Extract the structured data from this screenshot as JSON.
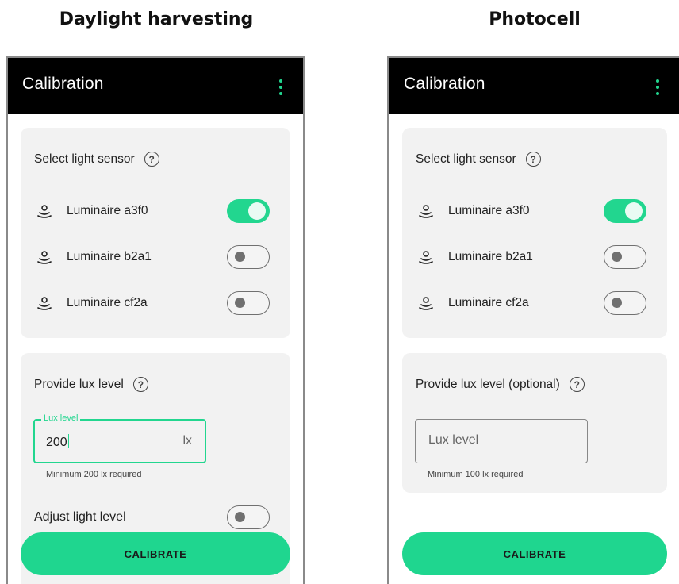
{
  "columns": {
    "left_title": "Daylight harvesting",
    "right_title": "Photocell"
  },
  "left": {
    "appbar": {
      "title": "Calibration",
      "menu_icon": "more-vert-icon"
    },
    "sensor_section": {
      "title": "Select light sensor",
      "help": "?",
      "sensors": [
        {
          "label": "Luminaire a3f0",
          "on": true
        },
        {
          "label": "Luminaire b2a1",
          "on": false
        },
        {
          "label": "Luminaire cf2a",
          "on": false
        }
      ]
    },
    "lux_section": {
      "title": "Provide lux level",
      "help": "?",
      "field_label": "Lux level",
      "field_value": "200",
      "unit": "lx",
      "helper": "Minimum 200 lx required"
    },
    "adjust": {
      "label": "Adjust light level",
      "on": false
    },
    "button": "CALIBRATE"
  },
  "right": {
    "appbar": {
      "title": "Calibration",
      "menu_icon": "more-vert-icon"
    },
    "sensor_section": {
      "title": "Select light sensor",
      "help": "?",
      "sensors": [
        {
          "label": "Luminaire a3f0",
          "on": true
        },
        {
          "label": "Luminaire b2a1",
          "on": false
        },
        {
          "label": "Luminaire cf2a",
          "on": false
        }
      ]
    },
    "lux_section": {
      "title": "Provide lux level (optional)",
      "help": "?",
      "placeholder": "Lux level",
      "helper": "Minimum 100 lx required"
    },
    "button": "CALIBRATE"
  },
  "colors": {
    "accent": "#22d68f",
    "appbar": "#000000",
    "card": "#f2f2f2"
  }
}
